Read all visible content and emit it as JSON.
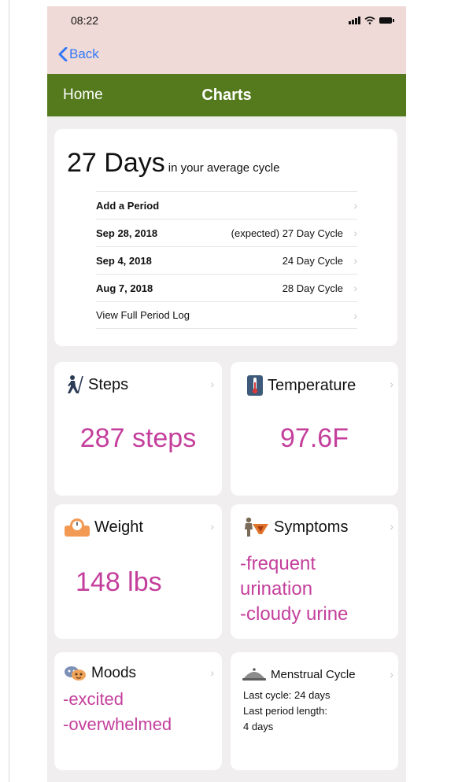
{
  "status_bar": {
    "time": "08:22"
  },
  "back": {
    "label": "Back"
  },
  "nav": {
    "home": "Home",
    "title": "Charts"
  },
  "cycle": {
    "days": "27 Days",
    "subtitle": "in your average cycle",
    "rows": [
      {
        "left": "Add a Period",
        "right": ""
      },
      {
        "left": "Sep 28, 2018",
        "right": "(expected) 27 Day Cycle"
      },
      {
        "left": "Sep 4, 2018",
        "right": "24 Day Cycle"
      },
      {
        "left": "Aug 7, 2018",
        "right": "28 Day Cycle"
      },
      {
        "left": "View Full Period Log",
        "right": ""
      }
    ]
  },
  "tiles": {
    "steps": {
      "title": "Steps",
      "value": "287 steps"
    },
    "temperature": {
      "title": "Temperature",
      "value": "97.6F"
    },
    "weight": {
      "title": "Weight",
      "value": "148 lbs"
    },
    "symptoms": {
      "title": "Symptoms",
      "items": [
        "-frequent",
        "urination",
        "-cloudy urine"
      ]
    },
    "moods": {
      "title": "Moods",
      "items": [
        "-excited",
        "-overwhelmed"
      ]
    },
    "menstrual": {
      "title": "Menstrual Cycle",
      "lines": [
        "Last cycle: 24 days",
        "Last period length:",
        "4 days"
      ]
    }
  },
  "colors": {
    "nav_green": "#557a1d",
    "status_pink": "#efdad7",
    "value_magenta": "#c43f9c",
    "link_blue": "#3478f6"
  },
  "icons": {
    "steps": "walking-person-icon",
    "temperature": "thermometer-icon",
    "weight": "scale-icon",
    "symptoms": "body-icon",
    "moods": "masks-icon",
    "menstrual": "cloche-icon"
  }
}
